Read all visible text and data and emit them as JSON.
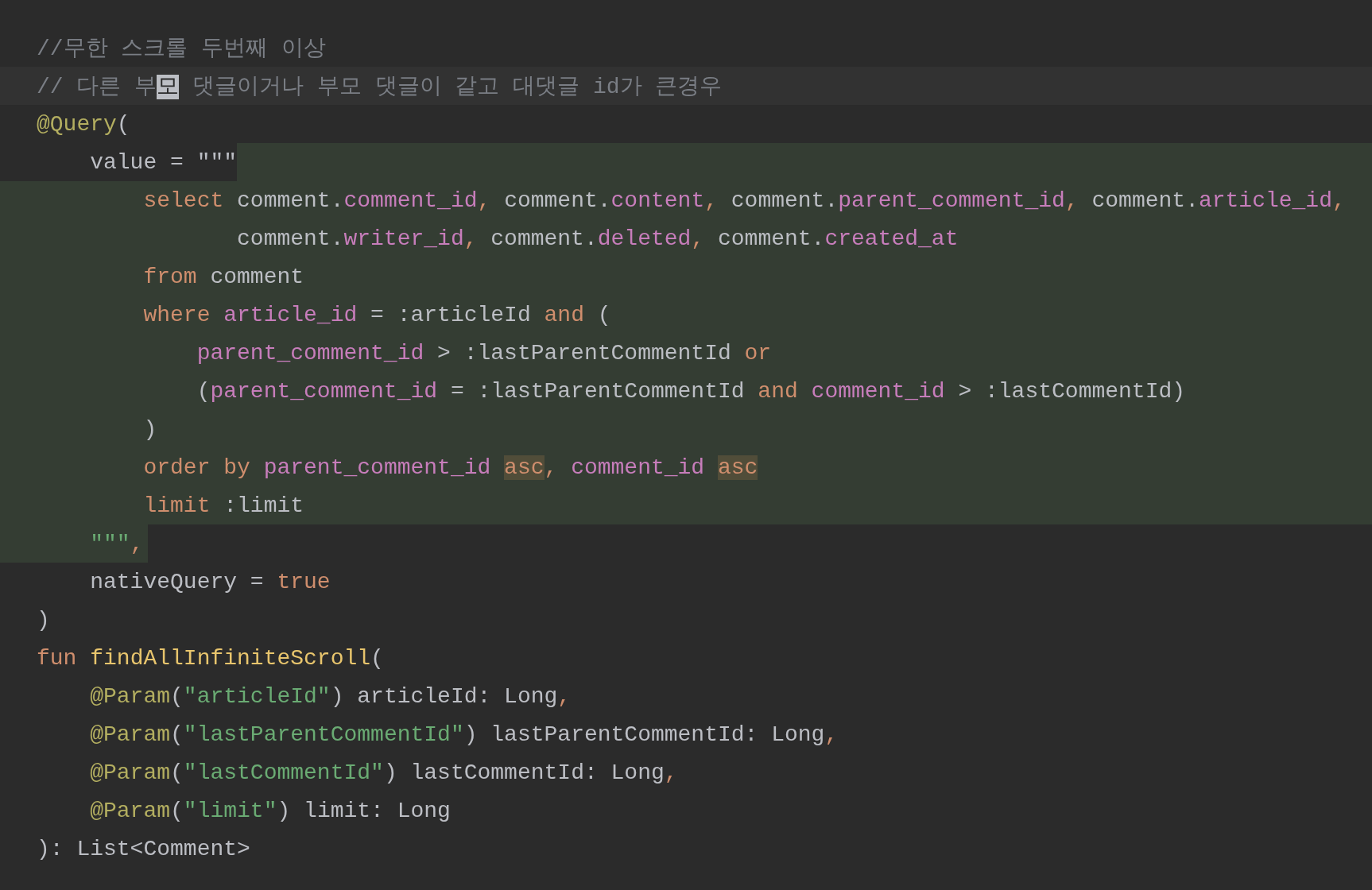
{
  "editor": {
    "lines": [
      {
        "kind": "flush",
        "current_line": false,
        "injected": false,
        "tokens": [
          {
            "kind": "comment",
            "text": "//무한 스크롤 두번째 이상"
          }
        ]
      },
      {
        "kind": "flush",
        "current_line": true,
        "injected": false,
        "tokens": [
          {
            "kind": "comment",
            "text": "// 다른 부"
          },
          {
            "kind": "comment",
            "text": "모",
            "selected": true
          },
          {
            "kind": "comment",
            "text": " 댓글이거나 부모 댓글이 같고 대댓글 id가 큰경우"
          }
        ]
      },
      {
        "kind": "flush",
        "current_line": false,
        "injected": false,
        "tokens": [
          {
            "kind": "annotation",
            "text": "@Query"
          },
          {
            "kind": "plain",
            "text": "("
          }
        ]
      },
      {
        "kind": "member",
        "current_line": false,
        "injected": true,
        "tokens": [
          {
            "kind": "plain",
            "text": "value = \"\"\""
          }
        ]
      },
      {
        "kind": "sql",
        "current_line": false,
        "injected": true,
        "tokens": [
          {
            "kind": "keyword",
            "text": "select"
          },
          {
            "kind": "plain",
            "text": " comment."
          },
          {
            "kind": "column",
            "text": "comment_id"
          },
          {
            "kind": "keyword",
            "text": ","
          },
          {
            "kind": "plain",
            "text": " comment."
          },
          {
            "kind": "column",
            "text": "content"
          },
          {
            "kind": "keyword",
            "text": ","
          },
          {
            "kind": "plain",
            "text": " comment."
          },
          {
            "kind": "column",
            "text": "parent_comment_id"
          },
          {
            "kind": "keyword",
            "text": ","
          },
          {
            "kind": "plain",
            "text": " comment."
          },
          {
            "kind": "column",
            "text": "article_id"
          },
          {
            "kind": "keyword",
            "text": ","
          }
        ]
      },
      {
        "kind": "wrapped",
        "current_line": false,
        "injected": true,
        "tokens": [
          {
            "kind": "plain",
            "text": "comment."
          },
          {
            "kind": "column",
            "text": "writer_id"
          },
          {
            "kind": "keyword",
            "text": ","
          },
          {
            "kind": "plain",
            "text": " comment."
          },
          {
            "kind": "column",
            "text": "deleted"
          },
          {
            "kind": "keyword",
            "text": ","
          },
          {
            "kind": "plain",
            "text": " comment."
          },
          {
            "kind": "column",
            "text": "created_at"
          }
        ]
      },
      {
        "kind": "sql",
        "current_line": false,
        "injected": true,
        "tokens": [
          {
            "kind": "keyword",
            "text": "from"
          },
          {
            "kind": "plain",
            "text": " comment"
          }
        ]
      },
      {
        "kind": "sql",
        "current_line": false,
        "injected": true,
        "tokens": [
          {
            "kind": "keyword",
            "text": "where "
          },
          {
            "kind": "column",
            "text": "article_id"
          },
          {
            "kind": "plain",
            "text": " = :articleId "
          },
          {
            "kind": "keyword",
            "text": "and"
          },
          {
            "kind": "plain",
            "text": " ("
          }
        ]
      },
      {
        "kind": "nested",
        "current_line": false,
        "injected": true,
        "tokens": [
          {
            "kind": "column",
            "text": "parent_comment_id"
          },
          {
            "kind": "plain",
            "text": " > :lastParentCommentId "
          },
          {
            "kind": "keyword",
            "text": "or"
          }
        ]
      },
      {
        "kind": "nested",
        "current_line": false,
        "injected": true,
        "tokens": [
          {
            "kind": "plain",
            "text": "("
          },
          {
            "kind": "column",
            "text": "parent_comment_id"
          },
          {
            "kind": "plain",
            "text": " = :lastParentCommentId "
          },
          {
            "kind": "keyword",
            "text": "and "
          },
          {
            "kind": "column",
            "text": "comment_id"
          },
          {
            "kind": "plain",
            "text": " > :lastCommentId)"
          }
        ]
      },
      {
        "kind": "sql",
        "current_line": false,
        "injected": true,
        "tokens": [
          {
            "kind": "plain",
            "text": ")"
          }
        ]
      },
      {
        "kind": "sql",
        "current_line": false,
        "injected": true,
        "tokens": [
          {
            "kind": "keyword",
            "text": "order by "
          },
          {
            "kind": "column",
            "text": "parent_comment_id "
          },
          {
            "kind": "keyword",
            "text": "asc",
            "marked": true
          },
          {
            "kind": "keyword",
            "text": ", "
          },
          {
            "kind": "column",
            "text": "comment_id "
          },
          {
            "kind": "keyword",
            "text": "asc",
            "marked": true
          }
        ]
      },
      {
        "kind": "sql",
        "current_line": false,
        "injected": true,
        "tokens": [
          {
            "kind": "keyword",
            "text": "limit"
          },
          {
            "kind": "plain",
            "text": " :limit"
          }
        ]
      },
      {
        "kind": "member",
        "current_line": false,
        "injected": true,
        "tokens": [
          {
            "kind": "string",
            "text": "\"\"\""
          },
          {
            "kind": "keyword",
            "text": ","
          }
        ]
      },
      {
        "kind": "member",
        "current_line": false,
        "injected": false,
        "tokens": [
          {
            "kind": "plain",
            "text": "nativeQuery = "
          },
          {
            "kind": "keyword",
            "text": "true"
          }
        ]
      },
      {
        "kind": "flush",
        "current_line": false,
        "injected": false,
        "tokens": [
          {
            "kind": "plain",
            "text": ")"
          }
        ]
      },
      {
        "kind": "flush",
        "current_line": false,
        "injected": false,
        "tokens": [
          {
            "kind": "keyword",
            "text": "fun "
          },
          {
            "kind": "function",
            "text": "findAllInfiniteScroll"
          },
          {
            "kind": "plain",
            "text": "("
          }
        ]
      },
      {
        "kind": "member",
        "current_line": false,
        "injected": false,
        "tokens": [
          {
            "kind": "annotation",
            "text": "@Param"
          },
          {
            "kind": "plain",
            "text": "("
          },
          {
            "kind": "string",
            "text": "\"articleId\""
          },
          {
            "kind": "plain",
            "text": ") articleId: Long"
          },
          {
            "kind": "keyword",
            "text": ","
          }
        ]
      },
      {
        "kind": "member",
        "current_line": false,
        "injected": false,
        "tokens": [
          {
            "kind": "annotation",
            "text": "@Param"
          },
          {
            "kind": "plain",
            "text": "("
          },
          {
            "kind": "string",
            "text": "\"lastParentCommentId\""
          },
          {
            "kind": "plain",
            "text": ") lastParentCommentId: Long"
          },
          {
            "kind": "keyword",
            "text": ","
          }
        ]
      },
      {
        "kind": "member",
        "current_line": false,
        "injected": false,
        "tokens": [
          {
            "kind": "annotation",
            "text": "@Param"
          },
          {
            "kind": "plain",
            "text": "("
          },
          {
            "kind": "string",
            "text": "\"lastCommentId\""
          },
          {
            "kind": "plain",
            "text": ") lastCommentId: Long"
          },
          {
            "kind": "keyword",
            "text": ","
          }
        ]
      },
      {
        "kind": "member",
        "current_line": false,
        "injected": false,
        "tokens": [
          {
            "kind": "annotation",
            "text": "@Param"
          },
          {
            "kind": "plain",
            "text": "("
          },
          {
            "kind": "string",
            "text": "\"limit\""
          },
          {
            "kind": "plain",
            "text": ") limit: Long"
          }
        ]
      },
      {
        "kind": "flush",
        "current_line": false,
        "injected": false,
        "tokens": [
          {
            "kind": "plain",
            "text": "): List<Comment>"
          }
        ]
      }
    ]
  }
}
